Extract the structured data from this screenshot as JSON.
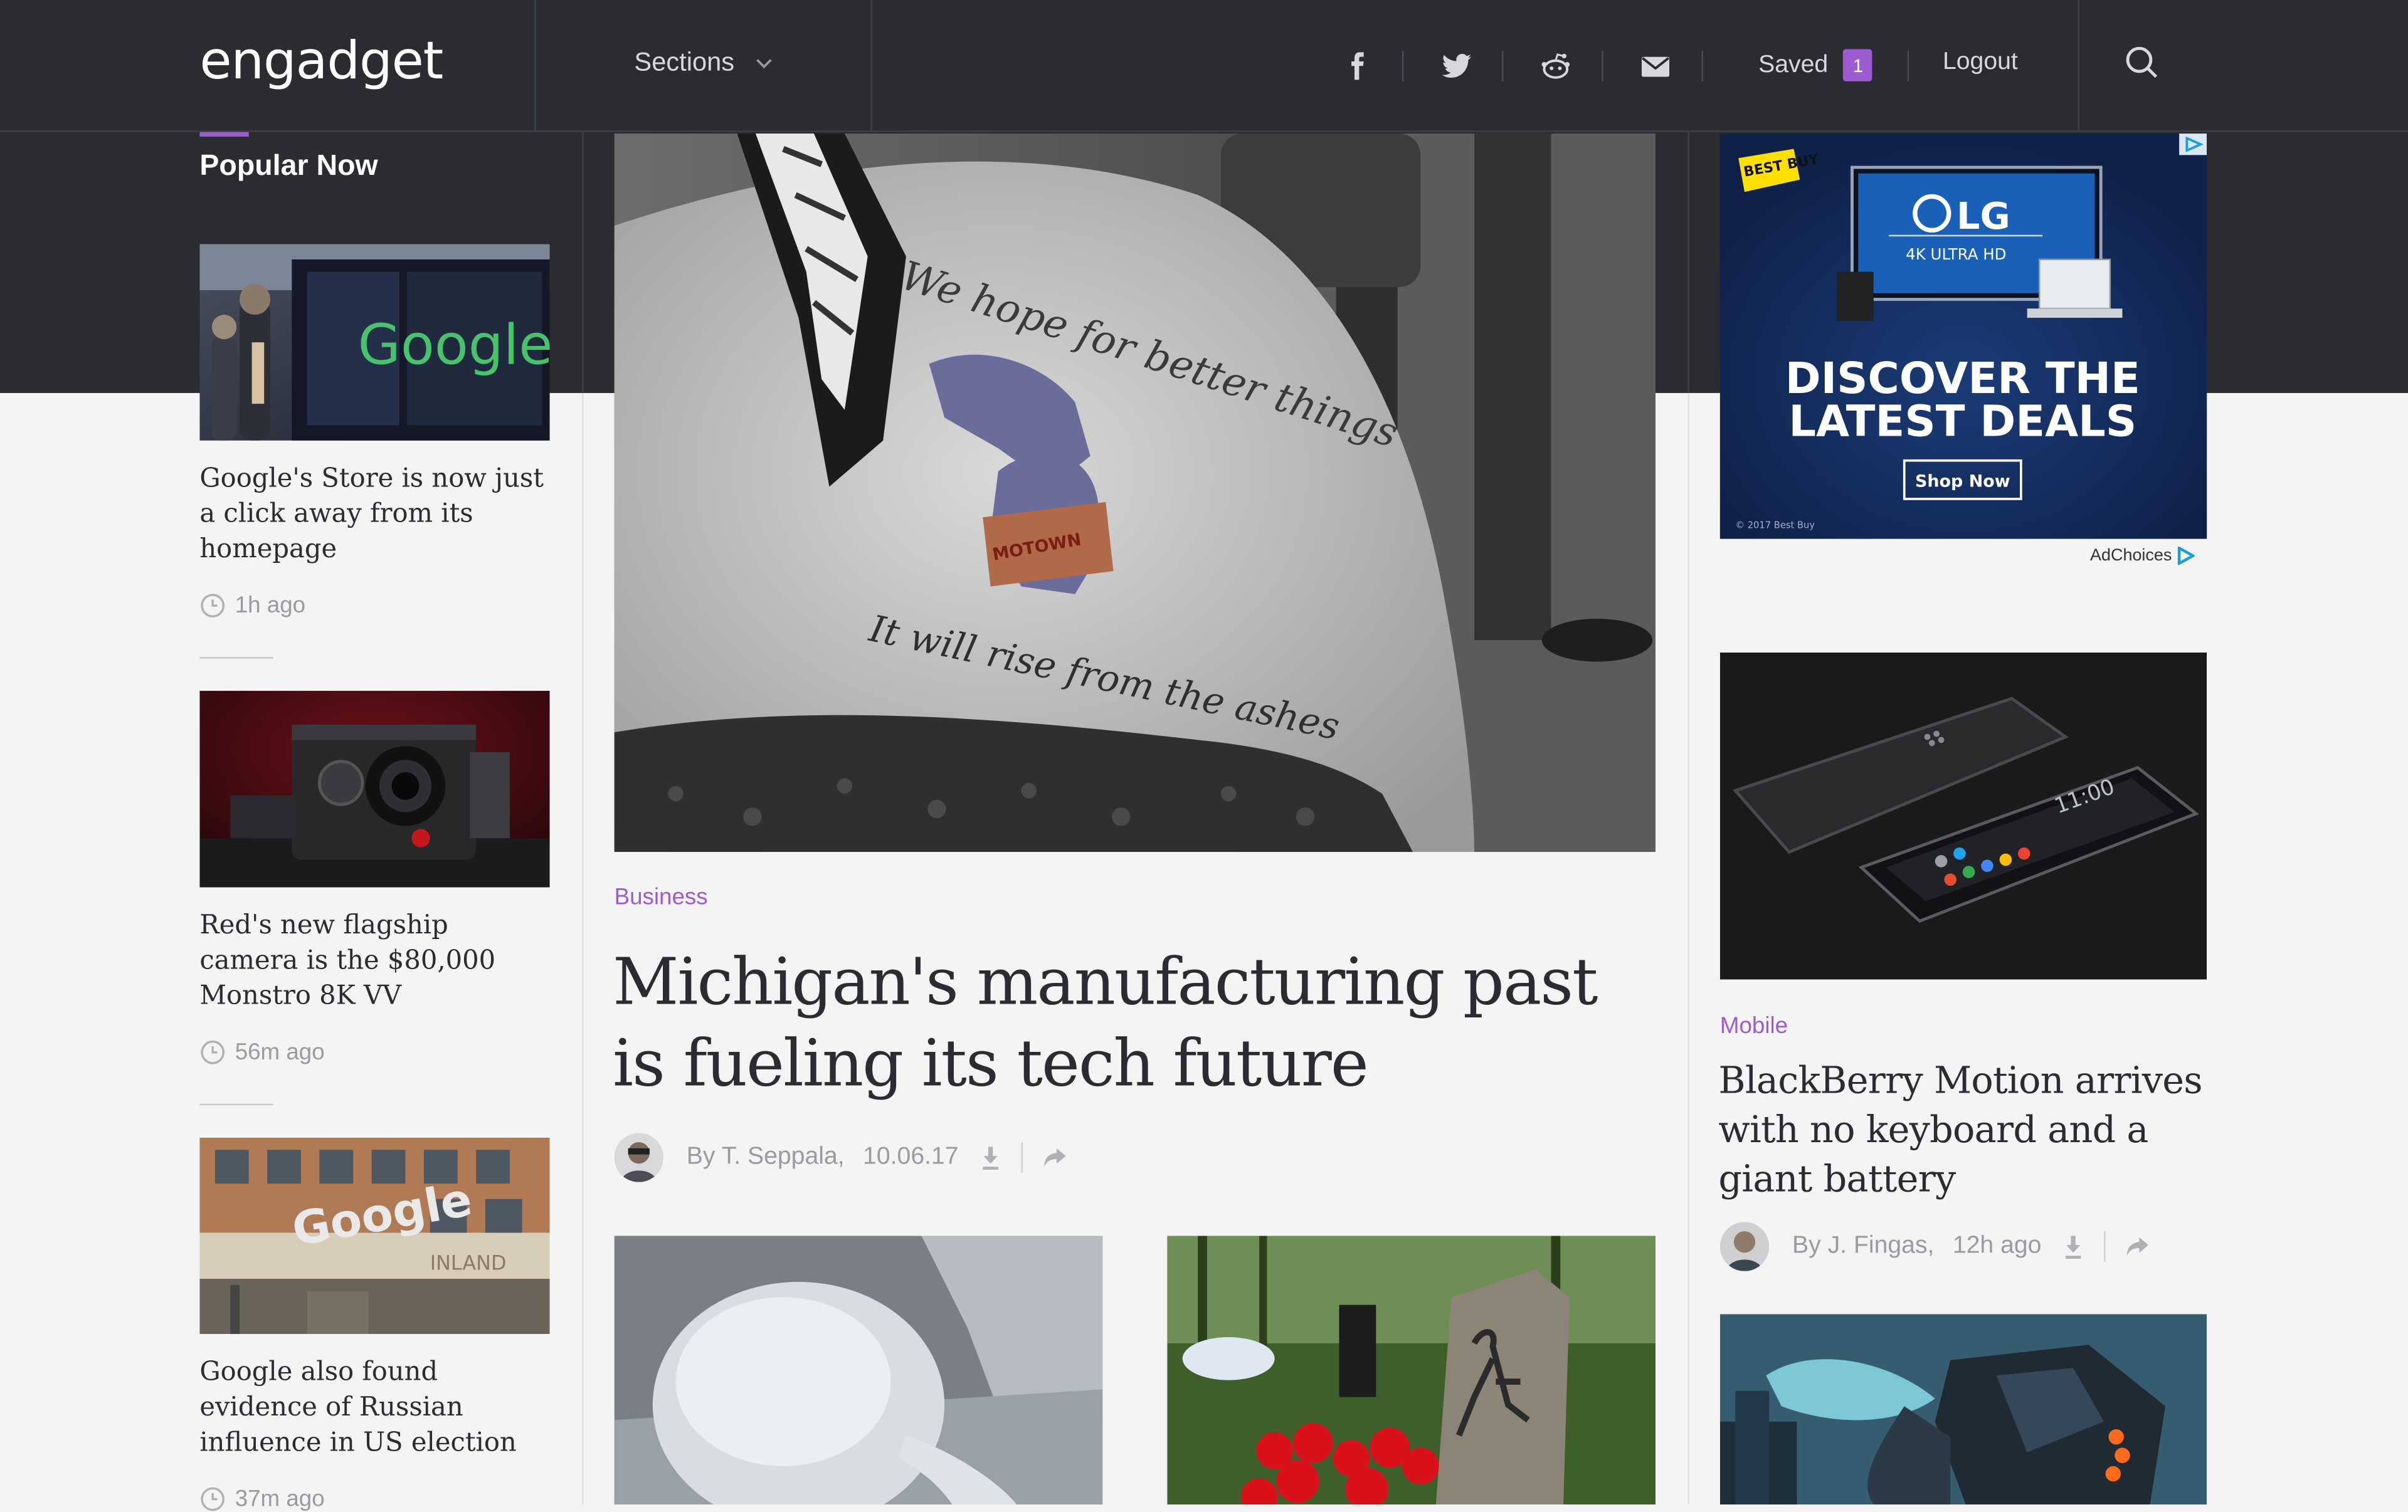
{
  "header": {
    "logo": "engadget",
    "sections_label": "Sections",
    "saved_label": "Saved",
    "saved_count": "1",
    "logout_label": "Logout",
    "social": [
      "facebook",
      "twitter",
      "reddit",
      "email"
    ]
  },
  "popular": {
    "title": "Popular Now",
    "items": [
      {
        "headline": "Google's Store is now just a click away from its homepage",
        "time": "1h ago"
      },
      {
        "headline": "Red's new flagship camera is the $80,000 Monstro 8K VV",
        "time": "56m ago"
      },
      {
        "headline": "Google also found evidence of Russian influence in US election",
        "time": "37m ago"
      }
    ],
    "thumb_texts": {
      "store": "Google",
      "office": "Google",
      "office_sub": "INLAND"
    }
  },
  "main": {
    "category": "Business",
    "headline": "Michigan's manufacturing past is fueling its tech future",
    "author": "By T. Seppala,",
    "date": "10.06.17",
    "hero_texts": {
      "tattoo_top": "We hope for better things",
      "tattoo_bottom": "It will rise from the ashes",
      "badge": "MOTOWN"
    }
  },
  "right": {
    "ad": {
      "retailer": "BEST BUY",
      "brand": "LG",
      "product": "4K ULTRA HD",
      "headline_line1": "DISCOVER THE",
      "headline_line2": "LATEST DEALS",
      "cta": "Shop Now",
      "legal": "© 2017 Best Buy",
      "adchoices": "AdChoices"
    },
    "category": "Mobile",
    "headline": "BlackBerry Motion arrives with no keyboard and a giant battery",
    "author": "By J. Fingas,",
    "time": "12h ago",
    "phone_clock": "11:00"
  },
  "colors": {
    "accent": "#9d5bd2",
    "dark": "#2b2c32",
    "page": "#f4f4f5"
  }
}
